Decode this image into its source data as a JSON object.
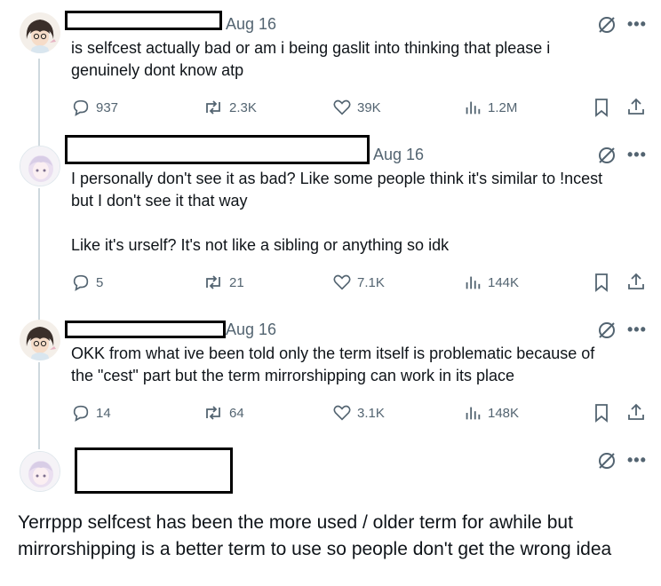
{
  "tweets": [
    {
      "date": "Aug 16",
      "text_lines": [
        "is selfcest actually bad or am i being gaslit into thinking that please i",
        "genuinely dont know atp"
      ],
      "stats": {
        "replies": "937",
        "reposts": "2.3K",
        "likes": "39K",
        "views": "1.2M"
      }
    },
    {
      "date": "Aug 16",
      "text_lines": [
        "I personally don't see it as bad? Like some people think it's similar to !ncest",
        "but I don't see it that way",
        "",
        "Like it's urself? It's not like a sibling or anything so idk"
      ],
      "stats": {
        "replies": "5",
        "reposts": "21",
        "likes": "7.1K",
        "views": "144K"
      }
    },
    {
      "date": "Aug 16",
      "text_lines": [
        "OKK from what ive been told only the term itself is problematic because of",
        "the \"cest\" part but the term mirrorshipping can work in its place"
      ],
      "stats": {
        "replies": "14",
        "reposts": "64",
        "likes": "3.1K",
        "views": "148K"
      }
    }
  ],
  "main_tweet": {
    "text_lines": [
      "Yerrppp selfcest has been the more used / older term for awhile but",
      "mirrorshipping is a better term to use so people don't get the wrong idea"
    ]
  },
  "colors": {
    "text": "#0f1419",
    "muted": "#536471",
    "thread_line": "#cfd9de"
  }
}
